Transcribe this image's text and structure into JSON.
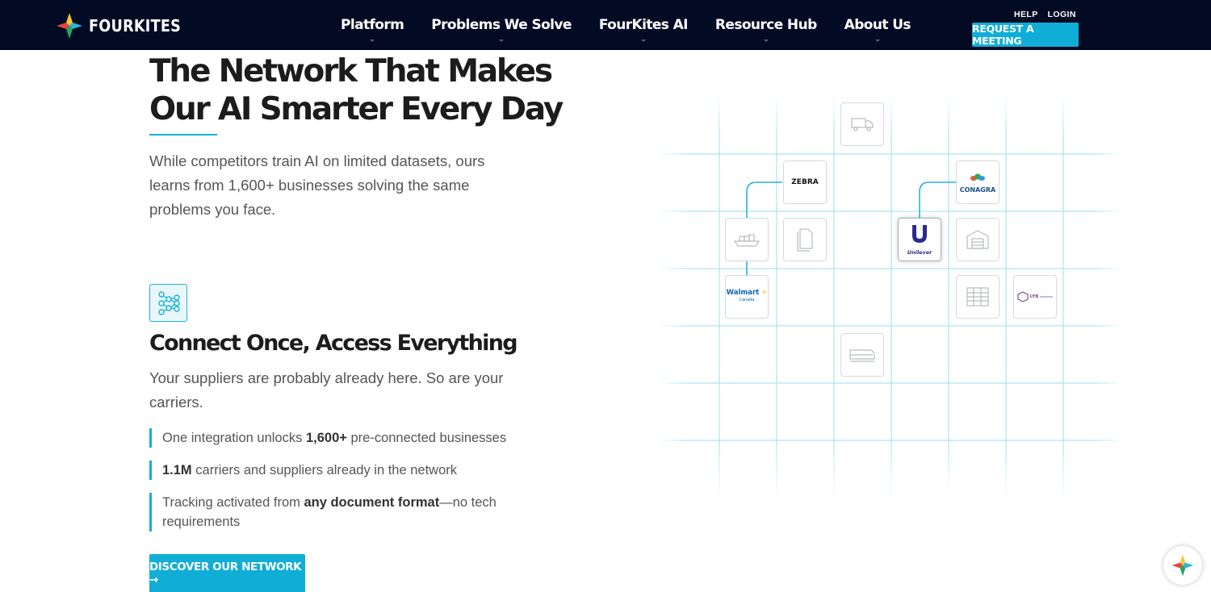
{
  "header": {
    "brand": "FOURKITES",
    "nav": [
      "Platform",
      "Problems We Solve",
      "FourKites AI",
      "Resource Hub",
      "About Us"
    ],
    "help": "HELP",
    "login": "LOGIN",
    "cta": "REQUEST A MEETING"
  },
  "hero": {
    "title": "The Network That Makes Our AI Smarter Every Day",
    "intro": "While competitors train AI on limited datasets, ours learns from 1,600+ businesses solving the same problems you face."
  },
  "feature": {
    "icon": "network-nodes-icon",
    "title": "Connect Once, Access Everything",
    "description": "Your suppliers are probably already here. So are your carriers.",
    "bullets": [
      {
        "pre": "One integration unlocks ",
        "bold": "1,600+",
        "post": " pre-connected businesses"
      },
      {
        "pre": "",
        "bold": "1.1M",
        "post": " carriers and suppliers already in the network"
      },
      {
        "pre": "Tracking activated from ",
        "bold": "any document format",
        "post": "—no tech requirements"
      }
    ],
    "cta": "DISCOVER OUR NETWORK →"
  },
  "network": {
    "brands": {
      "zebra": "ZEBRA",
      "conagra": "CONAGRA",
      "unilever": "Unilever",
      "walmart": "Walmart",
      "walmart_sub": "Canada",
      "lyb": "LYB"
    },
    "icons": [
      "truck-icon",
      "ship-icon",
      "document-icon",
      "warehouse-icon",
      "spreadsheet-icon",
      "train-icon"
    ]
  },
  "colors": {
    "accent": "#10aed6",
    "nav_bg": "#030b24",
    "grid_line": "#a9e6f3"
  },
  "chat_icon": "fourkites-chat-icon"
}
